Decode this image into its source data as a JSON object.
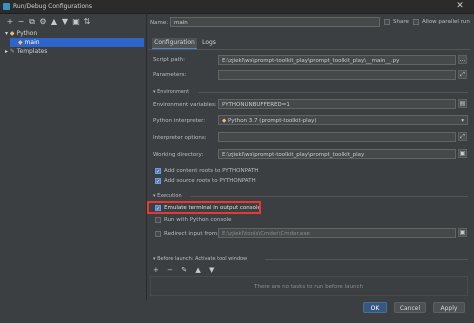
{
  "window": {
    "title": "Run/Debug Configurations",
    "close_glyph": "✕"
  },
  "toolbar": {
    "icons": [
      "+",
      "−",
      "⧉",
      "⚙",
      "▲",
      "▼",
      "▣",
      "⇅"
    ]
  },
  "tree": {
    "python_label": "Python",
    "main_label": "main",
    "templates_label": "Templates"
  },
  "header": {
    "name_label": "Name:",
    "name_value": "main",
    "share_label": "Share",
    "allow_parallel_label": "Allow parallel run"
  },
  "tabs": [
    {
      "label": "Configuration"
    },
    {
      "label": "Logs"
    }
  ],
  "config": {
    "script_path_label": "Script path:",
    "script_path_value": "E:\\zjiekl\\ws\\prompt-toolkit_play\\prompt_toolkit_play\\__main__.py",
    "parameters_label": "Parameters:",
    "parameters_value": "",
    "environment_section": "Environment",
    "env_vars_label": "Environment variables:",
    "env_vars_value": "PYTHONUNBUFFERED=1",
    "interpreter_label": "Python interpreter:",
    "interpreter_value": "Python 3.7 (prompt-toolkit-play)",
    "interp_options_label": "Interpreter options:",
    "interp_options_value": "",
    "working_dir_label": "Working directory:",
    "working_dir_value": "E:\\zjiekl\\ws\\prompt-toolkit_play\\prompt_toolkit_play",
    "add_content_roots": "Add content roots to PYTHONPATH",
    "add_source_roots": "Add source roots to PYTHONPATH",
    "execution_section": "Execution",
    "emulate_terminal": "Emulate terminal in output console",
    "run_with_console": "Run with Python console",
    "redirect_input": "Redirect input from:",
    "redirect_input_value": "E:\\zjiekl\\tools\\Cmder\\Cmder.exe",
    "before_launch_section": "Before launch: Activate tool window",
    "before_launch_empty": "There are no tasks to run before launch",
    "before_launch_tools": [
      "+",
      "−",
      "✎",
      "▲",
      "▼"
    ]
  },
  "footer": {
    "ok_label": "OK",
    "cancel_label": "Cancel",
    "apply_label": "Apply"
  },
  "colors": {
    "background": "#3c3f41",
    "selection": "#2f65ca",
    "highlight": "#e53935",
    "primary_button": "#365880"
  },
  "state": {
    "add_content_roots_checked": true,
    "add_source_roots_checked": true,
    "emulate_terminal_checked": true,
    "run_with_console_checked": false,
    "redirect_input_checked": false,
    "share_checked": false,
    "allow_parallel_checked": false
  }
}
